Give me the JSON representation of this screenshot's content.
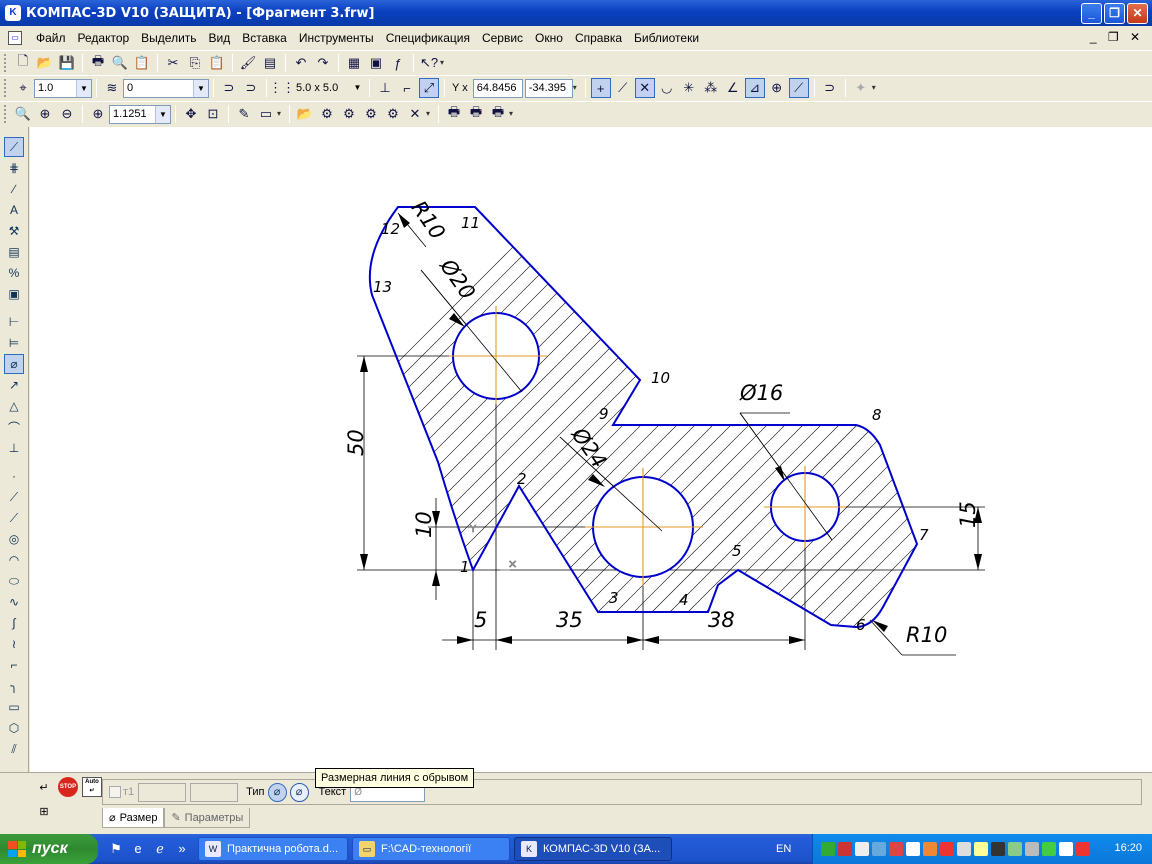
{
  "window": {
    "title": "КОМПАС-3D V10 (ЗАЩИТА) - [Фрагмент 3.frw]"
  },
  "menu": [
    "Файл",
    "Редактор",
    "Выделить",
    "Вид",
    "Вставка",
    "Инструменты",
    "Спецификация",
    "Сервис",
    "Окно",
    "Справка",
    "Библиотеки"
  ],
  "toolbar2": {
    "step_value": "1.0",
    "layer_value": "0",
    "grid_value": "5.0 x 5.0",
    "coord_x": "64.8456",
    "coord_y": "-34.395"
  },
  "toolbar3": {
    "zoom_value": "1.1251"
  },
  "drawing": {
    "point_labels": [
      "1",
      "2",
      "3",
      "4",
      "5",
      "6",
      "7",
      "8",
      "9",
      "10",
      "11",
      "12",
      "13"
    ],
    "dim_r10_top": "R10",
    "dim_d20": "Ø20",
    "dim_d16": "Ø16",
    "dim_d24": "Ø24",
    "dim_50": "50",
    "dim_10": "10",
    "dim_15": "15",
    "dim_5": "5",
    "dim_35": "35",
    "dim_38": "38",
    "dim_r10_bottom": "R10"
  },
  "properties": {
    "t1_label": "т1",
    "type_label": "Тип",
    "text_label": "Текст",
    "text_value": "Ø",
    "tooltip": "Размерная линия с обрывом",
    "tab_size": "Размер",
    "tab_params": "Параметры"
  },
  "taskbar": {
    "start": "пуск",
    "tasks": [
      "Практична робота.d...",
      "F:\\CAD-технологiї",
      "КОМПАС-3D V10 (ЗА..."
    ],
    "lang": "EN",
    "clock": "16:20"
  },
  "colors": {
    "titlebar": "#0a3fc0",
    "contour": "#0000cc",
    "axis": "#e39a22",
    "taskbar": "#245edb",
    "tray": "#0f8bec",
    "start": "#3c9a3c"
  }
}
